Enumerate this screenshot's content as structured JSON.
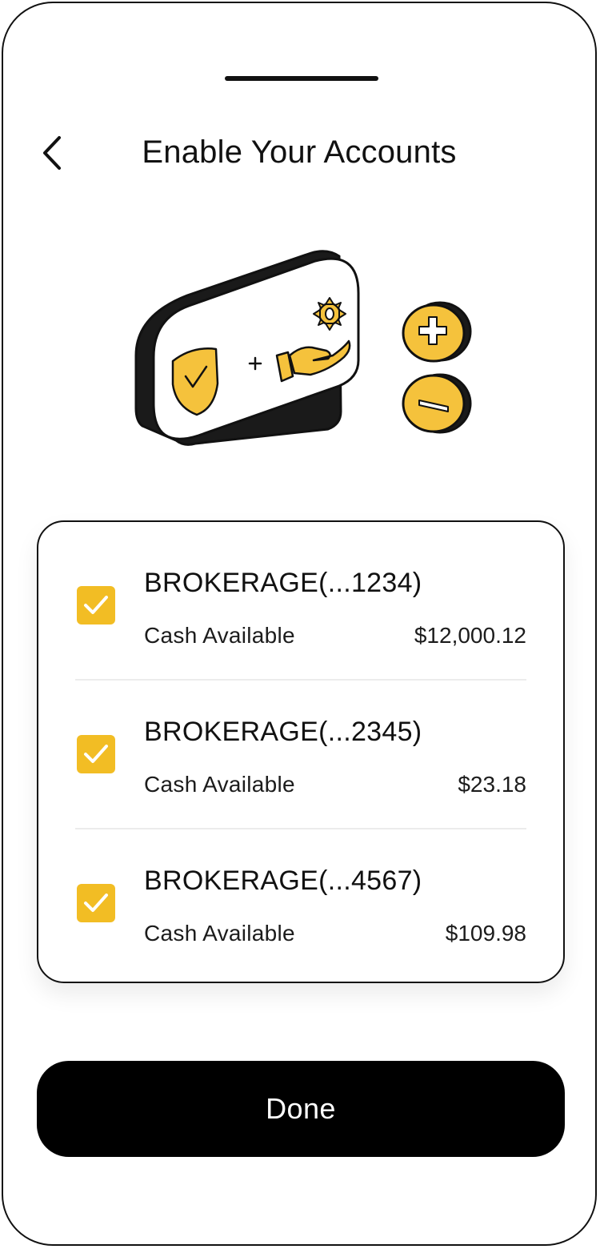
{
  "header": {
    "title": "Enable Your Accounts",
    "back_icon": "chevron-left-icon"
  },
  "illustration": {
    "icons": [
      "shield-check-icon",
      "plus-icon",
      "hand-gear-icon",
      "plus-coin-icon",
      "minus-coin-icon"
    ],
    "colors": {
      "accent": "#f2bd24",
      "outline": "#111111"
    }
  },
  "accounts": [
    {
      "name": "BROKERAGE(...1234)",
      "label": "Cash Available",
      "value": "$12,000.12",
      "checked": true
    },
    {
      "name": "BROKERAGE(...2345)",
      "label": "Cash Available",
      "value": "$23.18",
      "checked": true
    },
    {
      "name": "BROKERAGE(...4567)",
      "label": "Cash Available",
      "value": "$109.98",
      "checked": true
    }
  ],
  "footer": {
    "done_label": "Done"
  },
  "colors": {
    "accent": "#f2bd24",
    "button_bg": "#000000",
    "button_text": "#ffffff"
  }
}
